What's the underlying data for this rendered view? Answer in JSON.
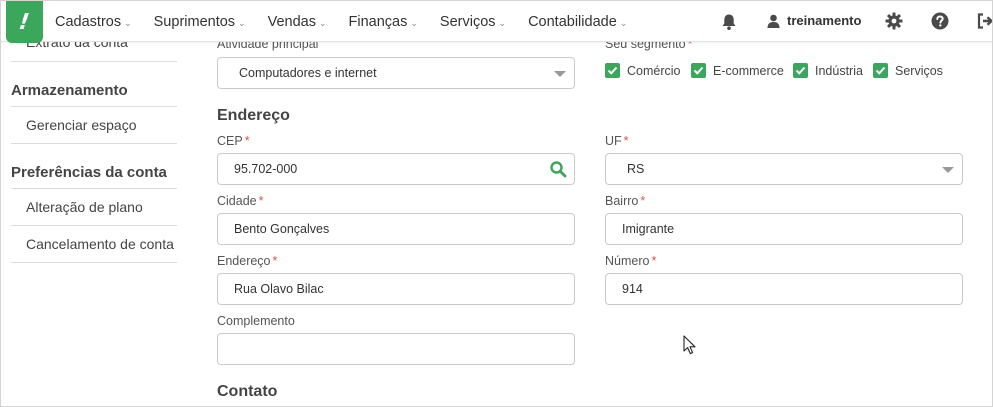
{
  "nav": {
    "logo": "!",
    "items": [
      {
        "label": "Cadastros"
      },
      {
        "label": "Suprimentos"
      },
      {
        "label": "Vendas"
      },
      {
        "label": "Finanças"
      },
      {
        "label": "Serviços"
      },
      {
        "label": "Contabilidade"
      }
    ],
    "user": "treinamento"
  },
  "sidebar": {
    "top_link": "Extrato da conta",
    "storage_heading": "Armazenamento",
    "storage_link": "Gerenciar espaço",
    "prefs_heading": "Preferências da conta",
    "prefs_links": [
      "Alteração de plano",
      "Cancelamento de conta"
    ]
  },
  "form": {
    "atividade": {
      "label": "Atividade principal",
      "value": "Computadores e internet"
    },
    "segmento": {
      "label": "Seu segmento",
      "options": [
        "Comércio",
        "E-commerce",
        "Indústria",
        "Serviços"
      ]
    },
    "endereco_section": "Endereço",
    "cep": {
      "label": "CEP",
      "value": "95.702-000"
    },
    "uf": {
      "label": "UF",
      "value": "RS"
    },
    "cidade": {
      "label": "Cidade",
      "value": "Bento Gonçalves"
    },
    "bairro": {
      "label": "Bairro",
      "value": "Imigrante"
    },
    "endereco": {
      "label": "Endereço",
      "value": "Rua Olavo Bilac"
    },
    "numero": {
      "label": "Número",
      "value": "914"
    },
    "complemento": {
      "label": "Complemento",
      "value": ""
    },
    "contato_section": "Contato",
    "required_mark": "*"
  },
  "colors": {
    "accent": "#3aa75b",
    "required": "#d9534f"
  },
  "icons": {
    "bell": "bell-icon",
    "user": "user-icon",
    "gear": "gear-icon",
    "help": "help-icon",
    "logout": "logout-icon",
    "search": "search-icon",
    "caret": "caret-down-icon",
    "check": "checkbox-checked-icon"
  }
}
